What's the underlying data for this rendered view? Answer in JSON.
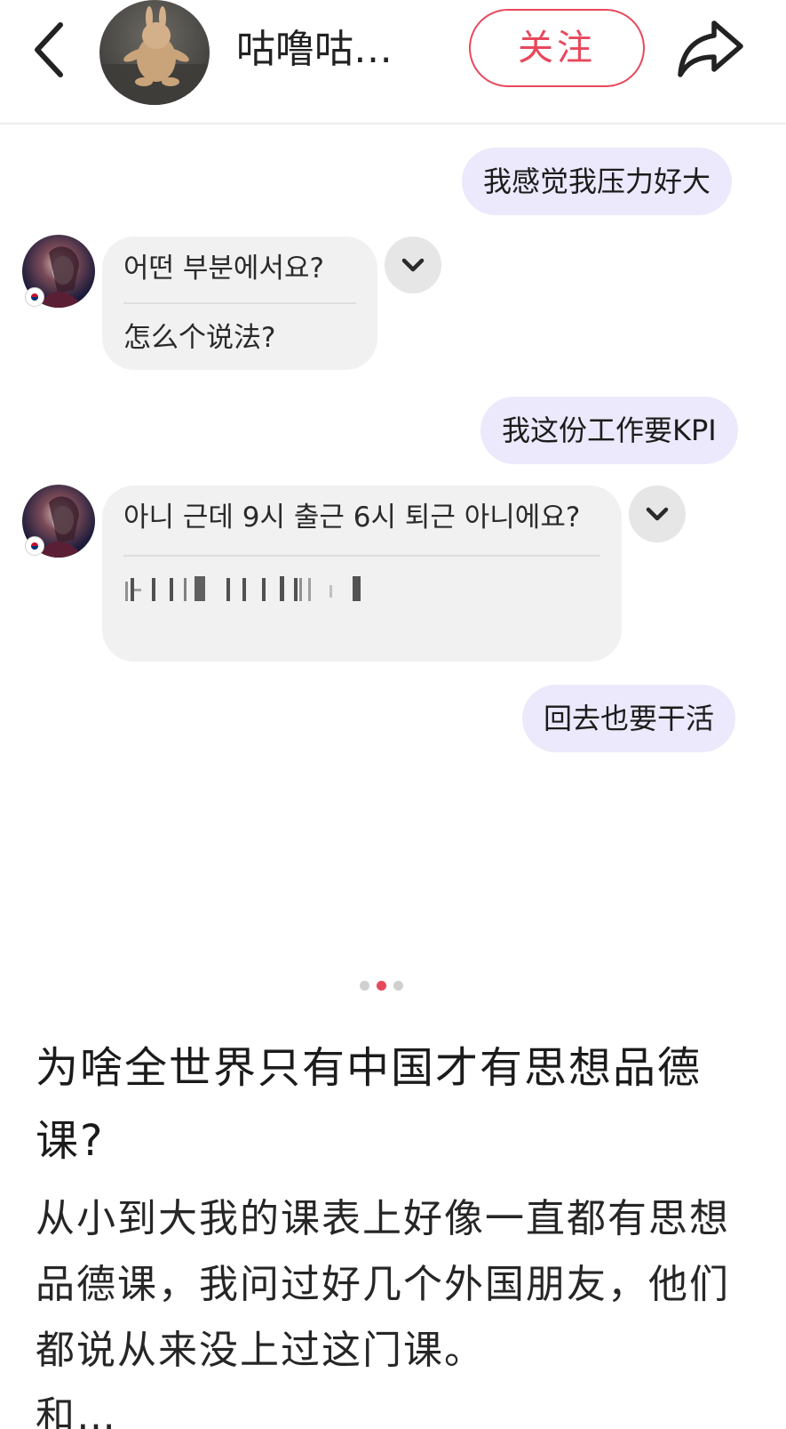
{
  "header": {
    "username": "咕噜咕…",
    "follow_label": "关注",
    "back_icon": "chevron-left-icon",
    "share_icon": "share-arrow-icon",
    "accent_color": "#e8485c"
  },
  "chat": {
    "messages": [
      {
        "side": "sent",
        "text": "我感觉我压力好大"
      },
      {
        "side": "received",
        "text": "어떤 부분에서요?",
        "translation": "怎么个说法?"
      },
      {
        "side": "sent",
        "text": "我这份工作要KPI"
      },
      {
        "side": "received",
        "text": "아니 근데 9시 출근 6시 퇴근 아니에요?",
        "translation": ""
      },
      {
        "side": "sent",
        "text": "回去也要干活"
      }
    ],
    "sent_bubble_color": "#ebe9fb",
    "received_bubble_color": "#f1f1f1"
  },
  "pager": {
    "count": 3,
    "active_index": 1
  },
  "post": {
    "title": "为啥全世界只有中国才有思想品德课?",
    "body": "从小到大我的课表上好像一直都有思想品德课，我问过好几个外国朋友，他们都说从来没上过这门课。",
    "body_cut": "和…"
  }
}
